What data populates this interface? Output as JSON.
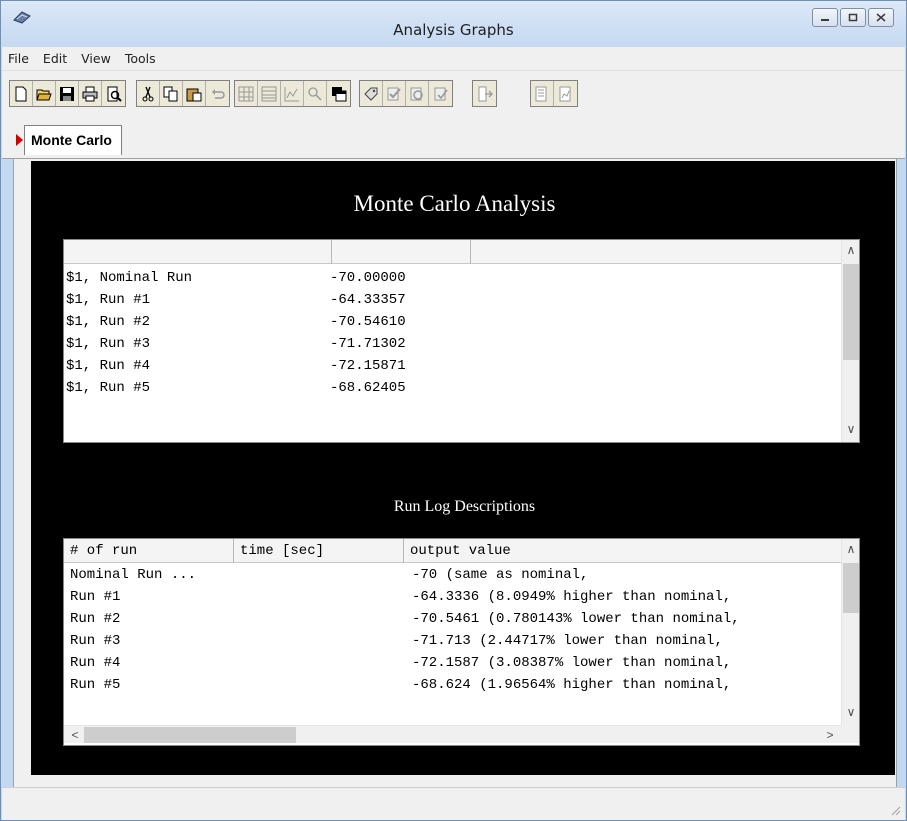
{
  "window": {
    "title": "Analysis Graphs"
  },
  "menu": [
    "File",
    "Edit",
    "View",
    "Tools"
  ],
  "toolbar": {
    "groups": [
      [
        "new-icon",
        "open-icon",
        "save-icon",
        "print-icon",
        "print-preview-icon"
      ],
      [
        "cut-icon",
        "copy-icon",
        "paste-icon",
        "undo-icon"
      ],
      [
        "grid-icon",
        "list-icon",
        "chart-icon",
        "zoom-icon",
        "window-icon"
      ],
      [
        "tag-icon",
        "check-icon",
        "refresh-icon",
        "mark-icon"
      ],
      [
        "export-icon"
      ],
      [
        "report-icon",
        "report-chart-icon"
      ]
    ]
  },
  "tab": {
    "label": "Monte Carlo"
  },
  "graph": {
    "title": "Monte Carlo Analysis",
    "results": {
      "headers": [
        "",
        "",
        ""
      ],
      "rows": [
        {
          "name": "$1, Nominal Run",
          "value": "-70.00000"
        },
        {
          "name": "$1, Run #1",
          "value": "-64.33357"
        },
        {
          "name": "$1, Run #2",
          "value": "-70.54610"
        },
        {
          "name": "$1, Run #3",
          "value": "-71.71302"
        },
        {
          "name": "$1, Run #4",
          "value": "-72.15871"
        },
        {
          "name": "$1, Run #5",
          "value": "-68.62405"
        }
      ]
    },
    "log_title": "Run Log Descriptions",
    "log": {
      "headers": [
        "# of run",
        "time [sec]",
        "output value"
      ],
      "rows": [
        {
          "run": "Nominal Run ...",
          "time": "",
          "output": "-70 (same as nominal,"
        },
        {
          "run": "Run #1",
          "time": "",
          "output": "-64.3336 (8.0949% higher than nominal,"
        },
        {
          "run": "Run #2",
          "time": "",
          "output": "-70.5461 (0.780143% lower than nominal,"
        },
        {
          "run": "Run #3",
          "time": "",
          "output": "-71.713 (2.44717% lower than nominal,"
        },
        {
          "run": "Run #4",
          "time": "",
          "output": "-72.1587 (3.08387% lower than nominal,"
        },
        {
          "run": "Run #5",
          "time": "",
          "output": "-68.624 (1.96564% higher than nominal,"
        }
      ]
    }
  },
  "colors": {
    "graph_background": "#000000",
    "tab_marker": "#d20000"
  }
}
